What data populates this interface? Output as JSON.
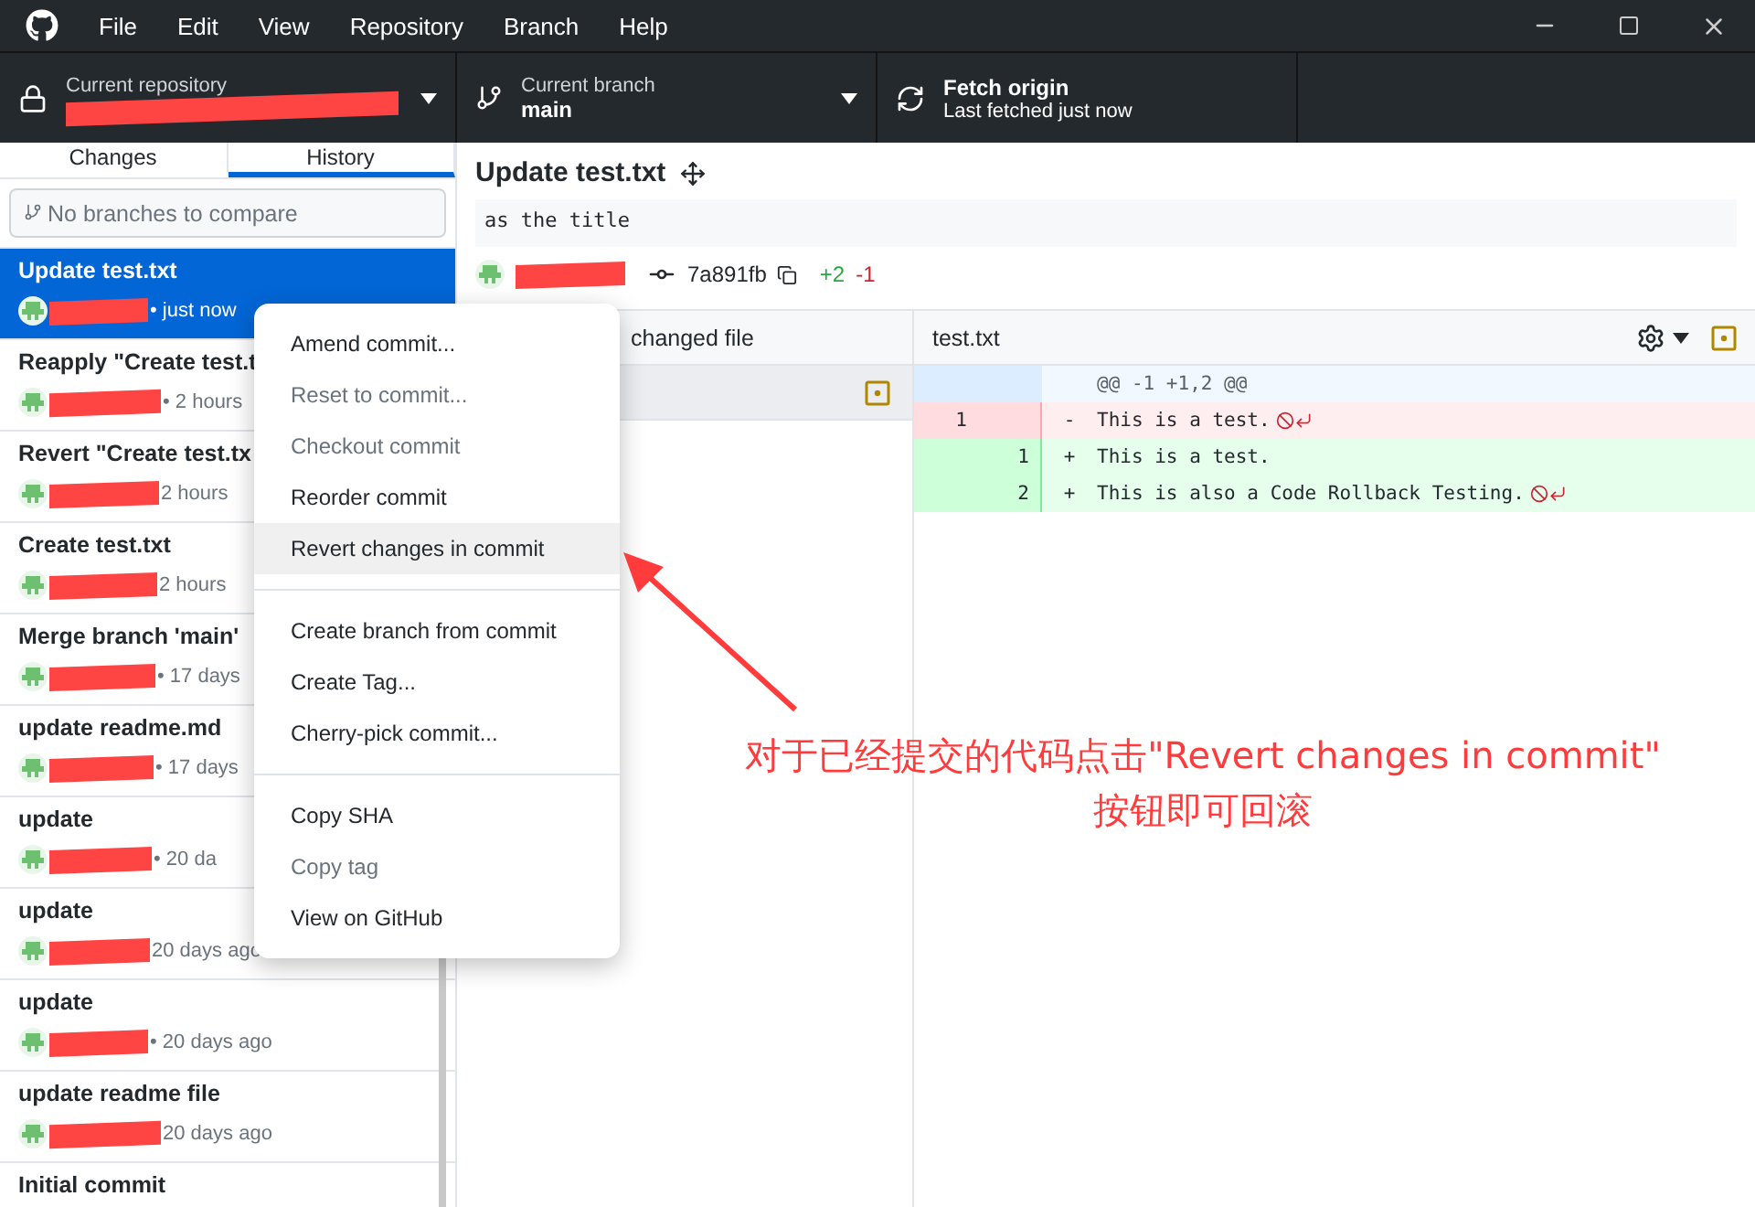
{
  "menu_bar": {
    "items": [
      "File",
      "Edit",
      "View",
      "Repository",
      "Branch",
      "Help"
    ]
  },
  "toolbar": {
    "repository": {
      "label": "Current repository"
    },
    "branch": {
      "label": "Current branch",
      "name": "main"
    },
    "fetch": {
      "title": "Fetch origin",
      "subtitle": "Last fetched just now"
    }
  },
  "sidebar": {
    "tabs": [
      {
        "label": "Changes",
        "selected": false
      },
      {
        "label": "History",
        "selected": true
      }
    ],
    "compare": {
      "placeholder": "No branches to compare"
    },
    "commits": [
      {
        "title": "Update test.txt",
        "time": "• just now",
        "selected": true
      },
      {
        "title": "Reapply \"Create test.t",
        "time": "• 2 hours",
        "selected": false
      },
      {
        "title": "Revert \"Create test.tx",
        "time": "2 hours",
        "selected": false
      },
      {
        "title": "Create test.txt",
        "time": "2 hours",
        "selected": false
      },
      {
        "title": "Merge branch 'main'",
        "time": "• 17 days",
        "selected": false
      },
      {
        "title": "update readme.md",
        "time": "• 17 days",
        "selected": false
      },
      {
        "title": "update",
        "time": "• 20 da",
        "selected": false
      },
      {
        "title": "update",
        "time": "20 days ago",
        "selected": false
      },
      {
        "title": "update",
        "time": "• 20 days ago",
        "selected": false
      },
      {
        "title": "update readme file",
        "time": "20 days ago",
        "selected": false
      },
      {
        "title": "Initial commit",
        "selected": false
      }
    ]
  },
  "commit": {
    "title": "Update test.txt",
    "message": "as the title",
    "sha": "7a891fb",
    "additions": "+2",
    "deletions": "-1"
  },
  "files": {
    "header": "changed file"
  },
  "diff": {
    "file": "test.txt",
    "lines": [
      {
        "kind": "hunk",
        "text": "@@ -1 +1,2 @@"
      },
      {
        "kind": "removed",
        "old": "1",
        "sign": "-",
        "text": "This is a test.",
        "no_newline": true
      },
      {
        "kind": "added",
        "new": "1",
        "sign": "+",
        "text": "This is a test.",
        "no_newline": false
      },
      {
        "kind": "added",
        "new": "2",
        "sign": "+",
        "text": "This is also a Code Rollback Testing.",
        "no_newline": true
      }
    ]
  },
  "context_menu": {
    "items": [
      {
        "kind": "item",
        "label": "Amend commit...",
        "disabled": false,
        "selected": false
      },
      {
        "kind": "item",
        "label": "Reset to commit...",
        "disabled": true,
        "selected": false
      },
      {
        "kind": "item",
        "label": "Checkout commit",
        "disabled": true,
        "selected": false
      },
      {
        "kind": "item",
        "label": "Reorder commit",
        "disabled": false,
        "selected": false
      },
      {
        "kind": "item",
        "label": "Revert changes in commit",
        "disabled": false,
        "selected": true
      },
      {
        "kind": "separator"
      },
      {
        "kind": "item",
        "label": "Create branch from commit",
        "disabled": false,
        "selected": false
      },
      {
        "kind": "item",
        "label": "Create Tag...",
        "disabled": false,
        "selected": false
      },
      {
        "kind": "item",
        "label": "Cherry-pick commit...",
        "disabled": false,
        "selected": false
      },
      {
        "kind": "separator"
      },
      {
        "kind": "item",
        "label": "Copy SHA",
        "disabled": false,
        "selected": false
      },
      {
        "kind": "item",
        "label": "Copy tag",
        "disabled": true,
        "selected": false
      },
      {
        "kind": "item",
        "label": "View on GitHub",
        "disabled": false,
        "selected": false
      }
    ]
  },
  "annotation": {
    "lines": [
      "对于已经提交的代码点击\"Revert changes in commit\"",
      "按钮即可回滚"
    ]
  }
}
